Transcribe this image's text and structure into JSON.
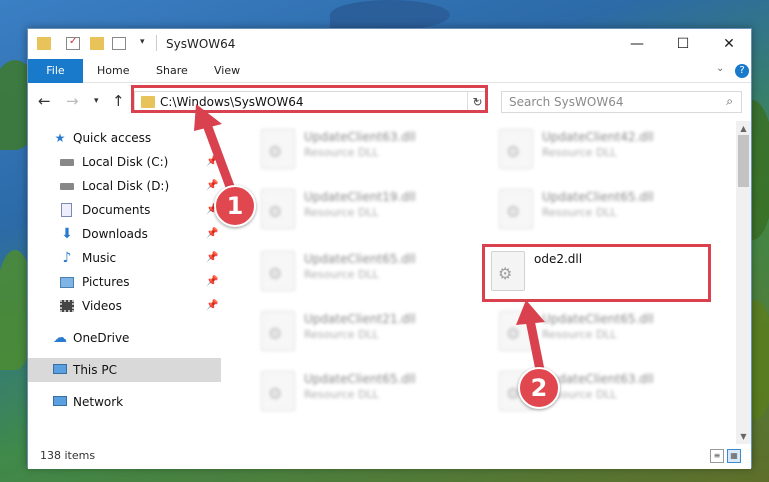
{
  "window": {
    "title": "SysWOW64",
    "controls": {
      "minimize": "—",
      "maximize": "☐",
      "close": "✕"
    }
  },
  "ribbon": {
    "tabs": [
      "File",
      "Home",
      "Share",
      "View"
    ]
  },
  "navigation": {
    "address": "C:\\Windows\\SysWOW64",
    "search_placeholder": "Search SysWOW64"
  },
  "sidebar": {
    "items": [
      {
        "label": "Quick access",
        "icon": "star-icon"
      },
      {
        "label": "Local Disk (C:)",
        "icon": "drive-icon",
        "pinned": true
      },
      {
        "label": "Local Disk (D:)",
        "icon": "drive-icon",
        "pinned": true
      },
      {
        "label": "Documents",
        "icon": "documents-icon",
        "pinned": true
      },
      {
        "label": "Downloads",
        "icon": "download-icon",
        "pinned": true
      },
      {
        "label": "Music",
        "icon": "music-icon",
        "pinned": true
      },
      {
        "label": "Pictures",
        "icon": "pictures-icon",
        "pinned": true
      },
      {
        "label": "Videos",
        "icon": "videos-icon",
        "pinned": true
      },
      {
        "label": "OneDrive",
        "icon": "cloud-icon"
      },
      {
        "label": "This PC",
        "icon": "computer-icon",
        "selected": true
      },
      {
        "label": "Network",
        "icon": "network-icon"
      }
    ]
  },
  "files": [
    {
      "name": "UpdateClient63.dll",
      "type": "Resource DLL"
    },
    {
      "name": "UpdateClient42.dll",
      "type": "Resource DLL"
    },
    {
      "name": "UpdateClient19.dll",
      "type": "Resource DLL"
    },
    {
      "name": "UpdateClient65.dll",
      "type": "Resource DLL"
    },
    {
      "name": "UpdateClient65.dll",
      "type": "Resource DLL"
    },
    {
      "name": "ode2.dll",
      "type": ""
    },
    {
      "name": "UpdateClient21.dll",
      "type": "Resource DLL"
    },
    {
      "name": "UpdateClient65.dll",
      "type": "Resource DLL"
    },
    {
      "name": "UpdateClient65.dll",
      "type": "Resource DLL"
    },
    {
      "name": "UpdateClient63.dll",
      "type": "Resource DLL"
    }
  ],
  "status": {
    "item_count": "138 items"
  },
  "callouts": {
    "step1": "1",
    "step2": "2"
  },
  "colors": {
    "highlight": "#d9414e",
    "file_tab": "#1979ca"
  }
}
